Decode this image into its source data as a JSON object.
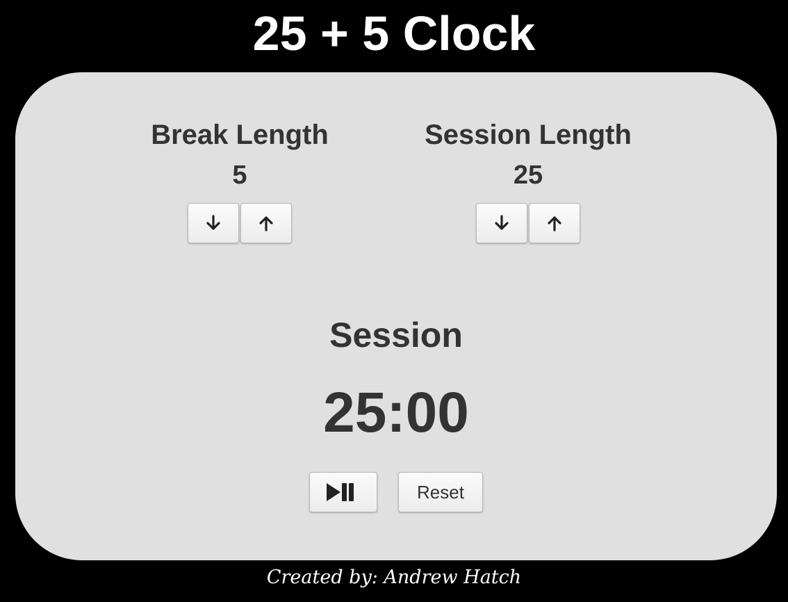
{
  "app": {
    "title": "25 + 5 Clock"
  },
  "break": {
    "label": "Break Length",
    "value": "5",
    "decrement_icon": "arrow-down-icon",
    "increment_icon": "arrow-up-icon"
  },
  "session": {
    "label": "Session Length",
    "value": "25",
    "decrement_icon": "arrow-down-icon",
    "increment_icon": "arrow-up-icon"
  },
  "timer": {
    "label": "Session",
    "time_left": "25:00"
  },
  "controls": {
    "start_stop_icon": "play-pause-icon",
    "reset_label": "Reset"
  },
  "footer": {
    "credit": "Created by: Andrew Hatch"
  },
  "colors": {
    "background": "#000000",
    "panel": "#e0e0e0",
    "text": "#333333",
    "title": "#ffffff"
  }
}
